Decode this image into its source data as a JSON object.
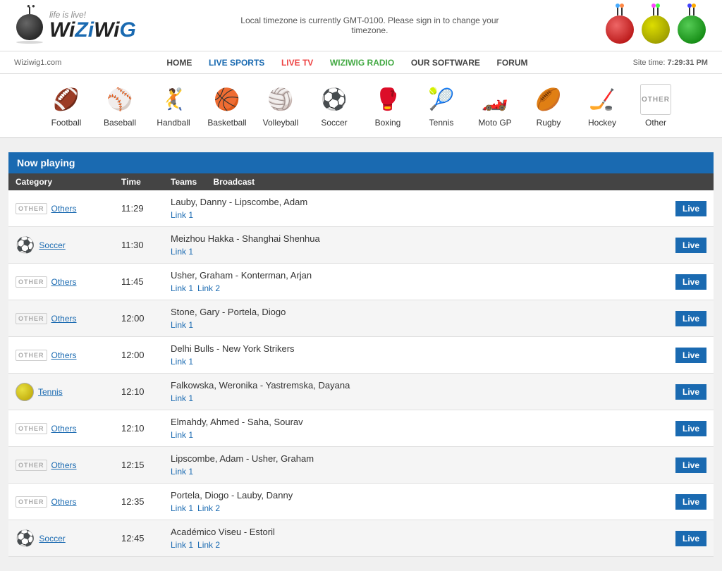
{
  "header": {
    "logo_main": "WiZiWiG",
    "logo_life": "life is live!",
    "timezone_notice": "Local timezone is currently GMT-0100. Please sign in to change your timezone.",
    "site_url": "Wiziwig1.com",
    "site_time_label": "Site time:",
    "site_time_value": "7:29:31 PM"
  },
  "nav": {
    "items": [
      {
        "label": "HOME",
        "class": "home"
      },
      {
        "label": "LIVE SPORTS",
        "class": "live-sports"
      },
      {
        "label": "LIVE TV",
        "class": "live-tv"
      },
      {
        "label": "WIZIWIG RADIO",
        "class": "radio"
      },
      {
        "label": "OUR SOFTWARE",
        "class": "software"
      },
      {
        "label": "FORUM",
        "class": "forum"
      }
    ]
  },
  "sports": [
    {
      "label": "Football",
      "icon": "🏈"
    },
    {
      "label": "Baseball",
      "icon": "⚾"
    },
    {
      "label": "Handball",
      "icon": "🤾"
    },
    {
      "label": "Basketball",
      "icon": "🏀"
    },
    {
      "label": "Volleyball",
      "icon": "🏐"
    },
    {
      "label": "Soccer",
      "icon": "⚽"
    },
    {
      "label": "Boxing",
      "icon": "🥊"
    },
    {
      "label": "Tennis",
      "icon": "🎾"
    },
    {
      "label": "Moto GP",
      "icon": "🏎️"
    },
    {
      "label": "Rugby",
      "icon": "🏉"
    },
    {
      "label": "Hockey",
      "icon": "🏒"
    },
    {
      "label": "Other",
      "icon": "OTHER"
    }
  ],
  "table": {
    "now_playing": "Now playing",
    "headers": [
      "Category",
      "Time",
      "Teams",
      "Broadcast",
      ""
    ],
    "rows": [
      {
        "cat_icon": "OTHER",
        "cat_label": "Others",
        "time": "11:29",
        "teams": "Lauby, Danny - Lipscombe, Adam",
        "links": [
          "Link 1"
        ],
        "live": true
      },
      {
        "cat_icon": "SOCCER",
        "cat_label": "Soccer",
        "time": "11:30",
        "teams": "Meizhou Hakka - Shanghai Shenhua",
        "links": [
          "Link 1"
        ],
        "live": true
      },
      {
        "cat_icon": "OTHER",
        "cat_label": "Others",
        "time": "11:45",
        "teams": "Usher, Graham - Konterman, Arjan",
        "links": [
          "Link 1",
          "Link 2"
        ],
        "live": true
      },
      {
        "cat_icon": "OTHER",
        "cat_label": "Others",
        "time": "12:00",
        "teams": "Stone, Gary - Portela, Diogo",
        "links": [
          "Link 1"
        ],
        "live": true
      },
      {
        "cat_icon": "OTHER",
        "cat_label": "Others",
        "time": "12:00",
        "teams": "Delhi Bulls - New York Strikers",
        "links": [
          "Link 1"
        ],
        "live": true
      },
      {
        "cat_icon": "TENNIS",
        "cat_label": "Tennis",
        "time": "12:10",
        "teams": "Falkowska, Weronika - Yastremska, Dayana",
        "links": [
          "Link 1"
        ],
        "live": true
      },
      {
        "cat_icon": "OTHER",
        "cat_label": "Others",
        "time": "12:10",
        "teams": "Elmahdy, Ahmed - Saha, Sourav",
        "links": [
          "Link 1"
        ],
        "live": true
      },
      {
        "cat_icon": "OTHER",
        "cat_label": "Others",
        "time": "12:15",
        "teams": "Lipscombe, Adam - Usher, Graham",
        "links": [
          "Link 1"
        ],
        "live": true
      },
      {
        "cat_icon": "OTHER",
        "cat_label": "Others",
        "time": "12:35",
        "teams": "Portela, Diogo - Lauby, Danny",
        "links": [
          "Link 1",
          "Link 2"
        ],
        "live": true
      },
      {
        "cat_icon": "SOCCER",
        "cat_label": "Soccer",
        "time": "12:45",
        "teams": "Académico Viseu - Estoril",
        "links": [
          "Link 1",
          "Link 2"
        ],
        "live": true
      }
    ]
  }
}
